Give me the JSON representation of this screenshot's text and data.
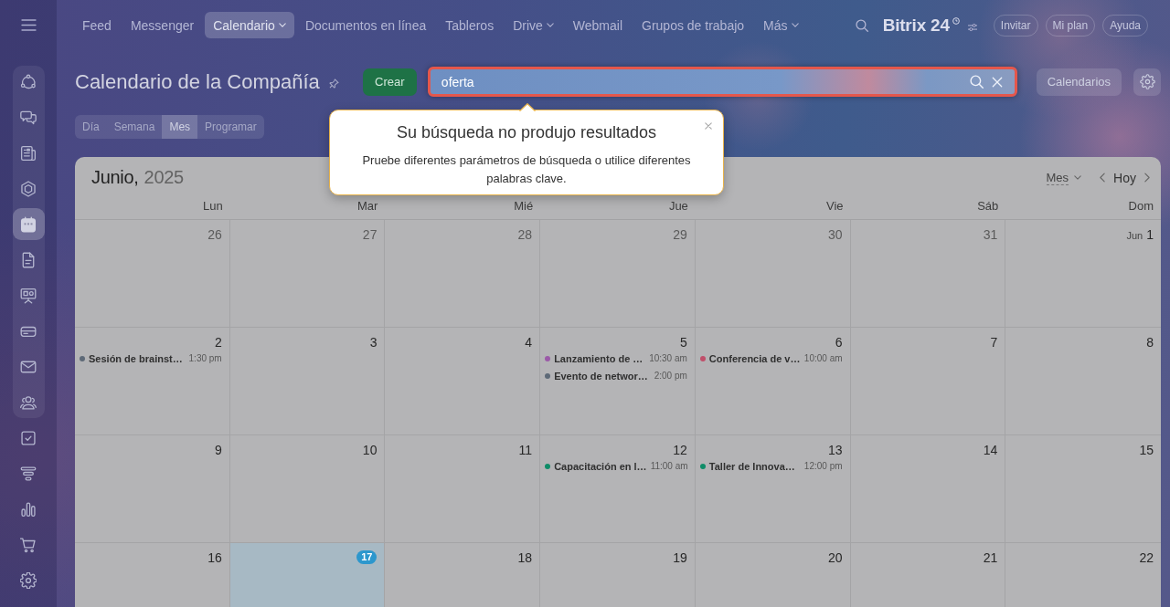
{
  "top_bar": {
    "nav": [
      {
        "label": "Feed",
        "selected": false,
        "dropdown": false
      },
      {
        "label": "Messenger",
        "selected": false,
        "dropdown": false
      },
      {
        "label": "Calendario",
        "selected": true,
        "dropdown": true
      },
      {
        "label": "Documentos en línea",
        "selected": false,
        "dropdown": false
      },
      {
        "label": "Tableros",
        "selected": false,
        "dropdown": false
      },
      {
        "label": "Drive",
        "selected": false,
        "dropdown": true
      },
      {
        "label": "Webmail",
        "selected": false,
        "dropdown": false
      },
      {
        "label": "Grupos de trabajo",
        "selected": false,
        "dropdown": false
      },
      {
        "label": "Más",
        "selected": false,
        "dropdown": true
      }
    ],
    "logo": "Bitrix 24",
    "buttons": [
      "Invitar",
      "Mi plan",
      "Ayuda"
    ]
  },
  "sidebar": {
    "sections": [
      {
        "framed": true,
        "items": [
          {
            "selected": false
          },
          {
            "selected": false
          },
          {
            "selected": false
          },
          {
            "selected": false
          },
          {
            "selected": true
          },
          {
            "selected": false
          },
          {
            "selected": false
          },
          {
            "selected": false
          },
          {
            "selected": false
          },
          {
            "selected": false
          }
        ]
      },
      {
        "framed": false,
        "items": [
          {
            "selected": false
          },
          {
            "selected": false
          },
          {
            "selected": false
          },
          {
            "selected": false
          },
          {
            "selected": false
          }
        ]
      }
    ]
  },
  "header": {
    "title": "Calendario de la Compañía",
    "create_button": "Crear",
    "search": {
      "value": "oferta",
      "highlighted": true
    },
    "calendars_button": "Calendarios"
  },
  "view_tabs": [
    {
      "label": "Día",
      "selected": false
    },
    {
      "label": "Semana",
      "selected": false
    },
    {
      "label": "Mes",
      "selected": true
    },
    {
      "label": "Programar",
      "selected": false
    }
  ],
  "popup": {
    "title": "Su búsqueda no produjo resultados",
    "message": "Pruebe diferentes parámetros de búsqueda o utilice diferentes palabras clave."
  },
  "calendar": {
    "month": "Junio,",
    "year": "2025",
    "view_selector": "Mes",
    "today_button": "Hoy",
    "weekdays": [
      "Lun",
      "Mar",
      "Mié",
      "Jue",
      "Vie",
      "Sáb",
      "Dom"
    ],
    "weeks": [
      {
        "days": [
          {
            "label": "26",
            "other_month": true,
            "today": false
          },
          {
            "label": "27",
            "other_month": true,
            "today": false
          },
          {
            "label": "28",
            "other_month": true,
            "today": false
          },
          {
            "label": "29",
            "other_month": true,
            "today": false
          },
          {
            "label": "30",
            "other_month": true,
            "today": false
          },
          {
            "label": "31",
            "other_month": true,
            "today": false
          },
          {
            "label": "1",
            "month_prefix": "Jun",
            "other_month": false,
            "today": false
          }
        ]
      },
      {
        "days": [
          {
            "label": "2",
            "other_month": false,
            "today": false,
            "events": [
              {
                "title": "Sesión de brainst…",
                "time": "1:30 pm",
                "color": "#5d6977"
              }
            ]
          },
          {
            "label": "3",
            "other_month": false,
            "today": false
          },
          {
            "label": "4",
            "other_month": false,
            "today": false
          },
          {
            "label": "5",
            "other_month": false,
            "today": false,
            "events": [
              {
                "title": "Lanzamiento de …",
                "time": "10:30 am",
                "color": "#9b5aa8"
              },
              {
                "title": "Evento de networ…",
                "time": "2:00 pm",
                "color": "#5d6977"
              }
            ]
          },
          {
            "label": "6",
            "other_month": false,
            "today": false,
            "events": [
              {
                "title": "Conferencia de v…",
                "time": "10:00 am",
                "color": "#c04f6a"
              }
            ]
          },
          {
            "label": "7",
            "other_month": false,
            "today": false
          },
          {
            "label": "8",
            "other_month": false,
            "today": false
          }
        ]
      },
      {
        "days": [
          {
            "label": "9",
            "other_month": false,
            "today": false
          },
          {
            "label": "10",
            "other_month": false,
            "today": false
          },
          {
            "label": "11",
            "other_month": false,
            "today": false
          },
          {
            "label": "12",
            "other_month": false,
            "today": false,
            "events": [
              {
                "title": "Capacitación en l…",
                "time": "11:00 am",
                "color": "#0f8c68"
              }
            ]
          },
          {
            "label": "13",
            "other_month": false,
            "today": false,
            "events": [
              {
                "title": "Taller de Innova…",
                "time": "12:00 pm",
                "color": "#0f8c68"
              }
            ]
          },
          {
            "label": "14",
            "other_month": false,
            "today": false
          },
          {
            "label": "15",
            "other_month": false,
            "today": false
          }
        ]
      },
      {
        "days": [
          {
            "label": "16",
            "other_month": false,
            "today": false
          },
          {
            "label": "17",
            "other_month": false,
            "today": true
          },
          {
            "label": "18",
            "other_month": false,
            "today": false
          },
          {
            "label": "19",
            "other_month": false,
            "today": false
          },
          {
            "label": "20",
            "other_month": false,
            "today": false
          },
          {
            "label": "21",
            "other_month": false,
            "today": false
          },
          {
            "label": "22",
            "other_month": false,
            "today": false
          }
        ]
      }
    ]
  }
}
